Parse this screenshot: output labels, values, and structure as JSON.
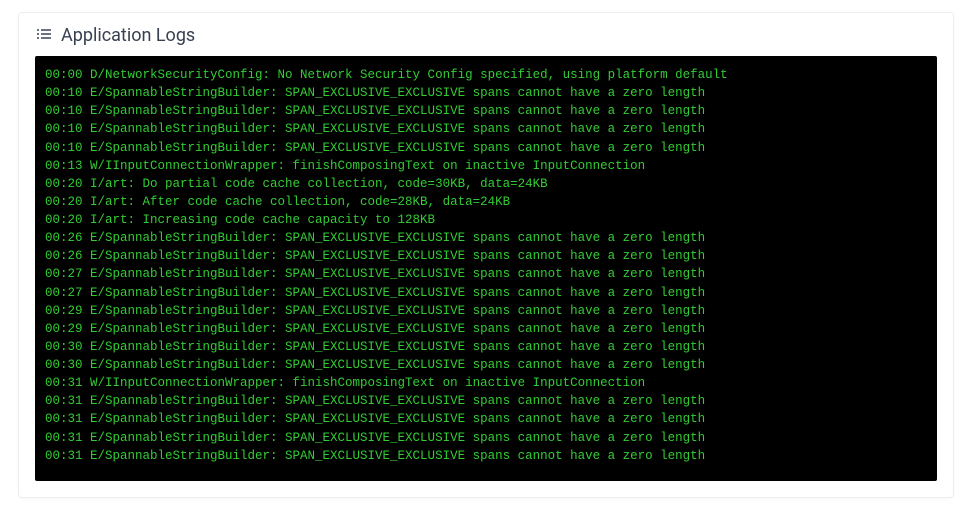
{
  "header": {
    "title": "Application Logs"
  },
  "logs": [
    {
      "time": "00:00",
      "level": "D",
      "tag": "NetworkSecurityConfig",
      "msg": "No Network Security Config specified, using platform default"
    },
    {
      "time": "00:10",
      "level": "E",
      "tag": "SpannableStringBuilder",
      "msg": "SPAN_EXCLUSIVE_EXCLUSIVE spans cannot have a zero length"
    },
    {
      "time": "00:10",
      "level": "E",
      "tag": "SpannableStringBuilder",
      "msg": "SPAN_EXCLUSIVE_EXCLUSIVE spans cannot have a zero length"
    },
    {
      "time": "00:10",
      "level": "E",
      "tag": "SpannableStringBuilder",
      "msg": "SPAN_EXCLUSIVE_EXCLUSIVE spans cannot have a zero length"
    },
    {
      "time": "00:10",
      "level": "E",
      "tag": "SpannableStringBuilder",
      "msg": "SPAN_EXCLUSIVE_EXCLUSIVE spans cannot have a zero length"
    },
    {
      "time": "00:13",
      "level": "W",
      "tag": "IInputConnectionWrapper",
      "msg": "finishComposingText on inactive InputConnection"
    },
    {
      "time": "00:20",
      "level": "I",
      "tag": "art",
      "msg": "Do partial code cache collection, code=30KB, data=24KB"
    },
    {
      "time": "00:20",
      "level": "I",
      "tag": "art",
      "msg": "After code cache collection, code=28KB, data=24KB"
    },
    {
      "time": "00:20",
      "level": "I",
      "tag": "art",
      "msg": "Increasing code cache capacity to 128KB"
    },
    {
      "time": "00:26",
      "level": "E",
      "tag": "SpannableStringBuilder",
      "msg": "SPAN_EXCLUSIVE_EXCLUSIVE spans cannot have a zero length"
    },
    {
      "time": "00:26",
      "level": "E",
      "tag": "SpannableStringBuilder",
      "msg": "SPAN_EXCLUSIVE_EXCLUSIVE spans cannot have a zero length"
    },
    {
      "time": "00:27",
      "level": "E",
      "tag": "SpannableStringBuilder",
      "msg": "SPAN_EXCLUSIVE_EXCLUSIVE spans cannot have a zero length"
    },
    {
      "time": "00:27",
      "level": "E",
      "tag": "SpannableStringBuilder",
      "msg": "SPAN_EXCLUSIVE_EXCLUSIVE spans cannot have a zero length"
    },
    {
      "time": "00:29",
      "level": "E",
      "tag": "SpannableStringBuilder",
      "msg": "SPAN_EXCLUSIVE_EXCLUSIVE spans cannot have a zero length"
    },
    {
      "time": "00:29",
      "level": "E",
      "tag": "SpannableStringBuilder",
      "msg": "SPAN_EXCLUSIVE_EXCLUSIVE spans cannot have a zero length"
    },
    {
      "time": "00:30",
      "level": "E",
      "tag": "SpannableStringBuilder",
      "msg": "SPAN_EXCLUSIVE_EXCLUSIVE spans cannot have a zero length"
    },
    {
      "time": "00:30",
      "level": "E",
      "tag": "SpannableStringBuilder",
      "msg": "SPAN_EXCLUSIVE_EXCLUSIVE spans cannot have a zero length"
    },
    {
      "time": "00:31",
      "level": "W",
      "tag": "IInputConnectionWrapper",
      "msg": "finishComposingText on inactive InputConnection"
    },
    {
      "time": "00:31",
      "level": "E",
      "tag": "SpannableStringBuilder",
      "msg": "SPAN_EXCLUSIVE_EXCLUSIVE spans cannot have a zero length"
    },
    {
      "time": "00:31",
      "level": "E",
      "tag": "SpannableStringBuilder",
      "msg": "SPAN_EXCLUSIVE_EXCLUSIVE spans cannot have a zero length"
    },
    {
      "time": "00:31",
      "level": "E",
      "tag": "SpannableStringBuilder",
      "msg": "SPAN_EXCLUSIVE_EXCLUSIVE spans cannot have a zero length"
    },
    {
      "time": "00:31",
      "level": "E",
      "tag": "SpannableStringBuilder",
      "msg": "SPAN_EXCLUSIVE_EXCLUSIVE spans cannot have a zero length"
    }
  ]
}
